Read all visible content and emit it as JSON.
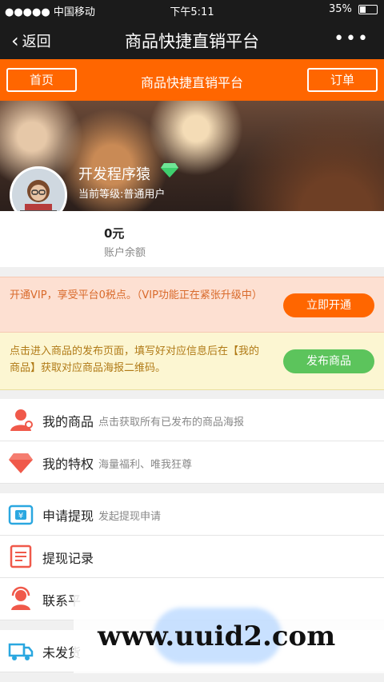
{
  "status_bar": {
    "signal": "●●●●● 中国移动",
    "time": "下午5:11",
    "battery": "35%"
  },
  "nav": {
    "back_label": "返回",
    "title": "商品快捷直销平台",
    "more": "•••"
  },
  "orange_bar": {
    "home": "首页",
    "title": "商品快捷直销平台",
    "orders": "订单"
  },
  "profile": {
    "username": "开发程序猿",
    "level": "当前等级:普通用户"
  },
  "balance": {
    "amount": "0元",
    "label": "账户余额"
  },
  "vip_notice": {
    "text": "开通VIP，享受平台0税点。（VIP功能正在紧张升级中）",
    "button": "立即开通",
    "button_color": "#ff6600"
  },
  "publish_notice": {
    "text": "点击进入商品的发布页面，填写好对应信息后在【我的商品】获取对应商品海报二维码。",
    "button": "发布商品",
    "button_color": "#5cc45c"
  },
  "menu_group1": [
    {
      "name": "我的商品",
      "desc": "点击获取所有已发布的商品海报",
      "icon": "user-icon"
    },
    {
      "name": "我的特权",
      "desc": "海量福利、唯我狂尊",
      "icon": "diamond-icon"
    }
  ],
  "menu_group2": [
    {
      "name": "申请提现",
      "desc": "发起提现申请",
      "icon": "wallet-icon"
    },
    {
      "name": "提现记录",
      "desc": "",
      "icon": "record-icon"
    },
    {
      "name": "联系平",
      "desc": "",
      "icon": "contact-icon"
    }
  ],
  "menu_group3": [
    {
      "name": "未发货",
      "desc": "",
      "icon": "truck-icon"
    }
  ],
  "watermark": "www.uuid2.com"
}
